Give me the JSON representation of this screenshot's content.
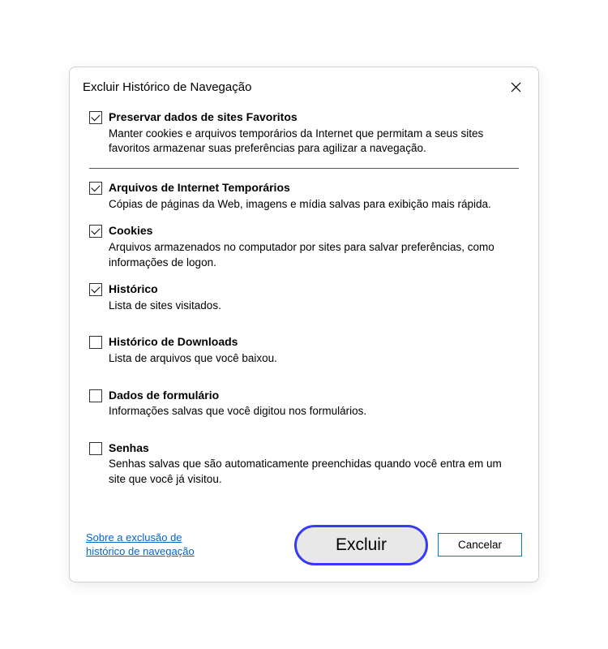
{
  "dialog": {
    "title": "Excluir Histórico de Navegação"
  },
  "options": {
    "favorites": {
      "label": "Preservar dados de sites Favoritos",
      "desc": "Manter cookies e arquivos temporários da Internet que permitam a seus sites favoritos armazenar suas preferências para agilizar a navegação.",
      "checked": true
    },
    "temp_files": {
      "label": "Arquivos de Internet Temporários",
      "desc": "Cópias de páginas da Web, imagens e mídia salvas para exibição mais rápida.",
      "checked": true
    },
    "cookies": {
      "label": "Cookies",
      "desc": "Arquivos armazenados no computador por sites para salvar preferências, como informações de logon.",
      "checked": true
    },
    "history": {
      "label": "Histórico",
      "desc": "Lista de sites visitados.",
      "checked": true
    },
    "downloads": {
      "label": "Histórico de Downloads",
      "desc": "Lista de arquivos que você baixou.",
      "checked": false
    },
    "form_data": {
      "label": "Dados de formulário",
      "desc": "Informações salvas que você digitou nos formulários.",
      "checked": false
    },
    "passwords": {
      "label": "Senhas",
      "desc": "Senhas salvas que são automaticamente preenchidas quando você entra em um site que você já visitou.",
      "checked": false
    }
  },
  "footer": {
    "help_link": "Sobre a exclusão de histórico de navegação",
    "delete_button": "Excluir",
    "cancel_button": "Cancelar"
  }
}
